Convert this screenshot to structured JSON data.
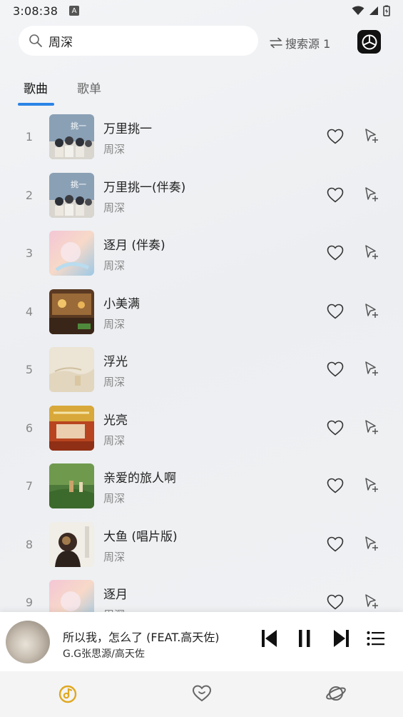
{
  "status_bar": {
    "time": "3:08:38",
    "notification_icon": "a-icon",
    "icons": [
      "wifi-icon",
      "signal-icon",
      "battery-charging-icon"
    ]
  },
  "search": {
    "query": "周深",
    "icon": "search-icon"
  },
  "source_switch": {
    "label": "搜索源 1",
    "icon": "swap-icon"
  },
  "app_logo": {
    "icon": "app-logo-icon"
  },
  "tabs": [
    {
      "label": "歌曲",
      "active": true
    },
    {
      "label": "歌单",
      "active": false
    }
  ],
  "songs": [
    {
      "index": "1",
      "title": "万里挑一",
      "artist": "周深"
    },
    {
      "index": "2",
      "title": "万里挑一(伴奏)",
      "artist": "周深"
    },
    {
      "index": "3",
      "title": "逐月 (伴奏)",
      "artist": "周深"
    },
    {
      "index": "4",
      "title": "小美满",
      "artist": "周深"
    },
    {
      "index": "5",
      "title": "浮光",
      "artist": "周深"
    },
    {
      "index": "6",
      "title": "光亮",
      "artist": "周深"
    },
    {
      "index": "7",
      "title": "亲爱的旅人啊",
      "artist": "周深"
    },
    {
      "index": "8",
      "title": "大鱼 (唱片版)",
      "artist": "周深"
    },
    {
      "index": "9",
      "title": "逐月",
      "artist": "周深"
    }
  ],
  "now_playing": {
    "title": "所以我，怎么了 (FEAT.高天佐)",
    "artist": "G.G张思源/高天佐",
    "state": "playing"
  },
  "bottom_nav": [
    {
      "name": "home",
      "icon": "music-disc-icon",
      "active": true
    },
    {
      "name": "favorites",
      "icon": "heart-icon",
      "active": false
    },
    {
      "name": "discover",
      "icon": "planet-icon",
      "active": false
    }
  ],
  "colors": {
    "accent": "#2b84e6",
    "active_nav": "#e0a820",
    "icon_gray": "#444444"
  }
}
